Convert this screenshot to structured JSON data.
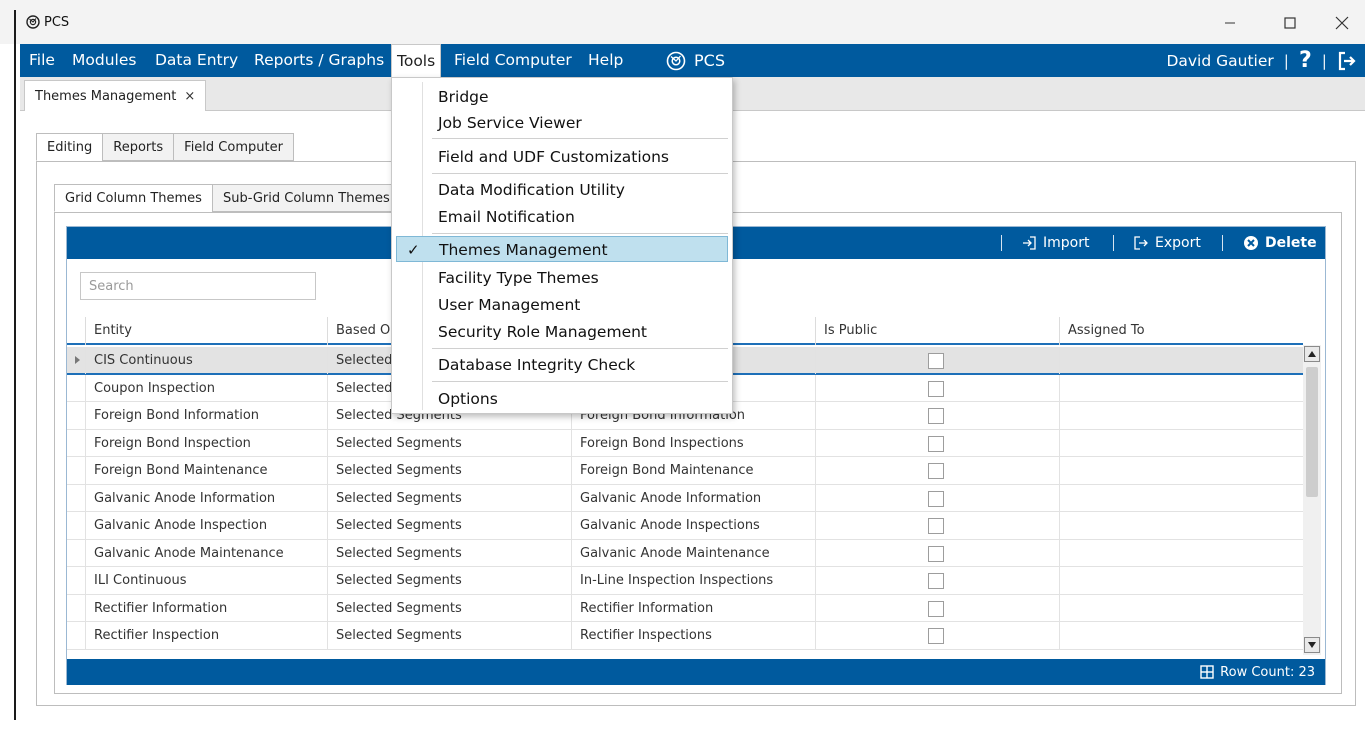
{
  "window": {
    "title": "PCS",
    "controls": [
      "—",
      "☐",
      "✕"
    ]
  },
  "menubar": {
    "items": [
      {
        "label": "File"
      },
      {
        "label": "Modules"
      },
      {
        "label": "Data Entry"
      },
      {
        "label": "Reports / Graphs"
      },
      {
        "label": "Tools"
      },
      {
        "label": "Field Computer"
      },
      {
        "label": "Help"
      }
    ],
    "brand": "PCS",
    "user": "David Gautier",
    "separator": "|",
    "help_glyph": "?"
  },
  "doc_tab": {
    "label": "Themes Management",
    "close": "×"
  },
  "editing_tabs": [
    "Editing",
    "Reports",
    "Field Computer"
  ],
  "theme_tabs": [
    "Grid Column Themes",
    "Sub-Grid Column Themes"
  ],
  "toolbar": {
    "import_label": "Import",
    "export_label": "Export",
    "delete_label": "Delete"
  },
  "search": {
    "placeholder": "Search"
  },
  "columns": [
    "Entity",
    "Based On",
    "",
    "Is Public",
    "Assigned To"
  ],
  "rows": [
    {
      "entity": "CIS Continuous",
      "based_on": "Selected",
      "source": "",
      "is_public": false
    },
    {
      "entity": "Coupon Inspection",
      "based_on": "Selected",
      "source": "",
      "is_public": false
    },
    {
      "entity": "Foreign Bond Information",
      "based_on": "Selected Segments",
      "source": "Foreign Bond Information",
      "is_public": false
    },
    {
      "entity": "Foreign Bond Inspection",
      "based_on": "Selected Segments",
      "source": "Foreign Bond Inspections",
      "is_public": false
    },
    {
      "entity": "Foreign Bond Maintenance",
      "based_on": "Selected Segments",
      "source": "Foreign Bond Maintenance",
      "is_public": false
    },
    {
      "entity": "Galvanic Anode Information",
      "based_on": "Selected Segments",
      "source": "Galvanic Anode Information",
      "is_public": false
    },
    {
      "entity": "Galvanic Anode Inspection",
      "based_on": "Selected Segments",
      "source": "Galvanic Anode Inspections",
      "is_public": false
    },
    {
      "entity": "Galvanic Anode Maintenance",
      "based_on": "Selected Segments",
      "source": "Galvanic Anode Maintenance",
      "is_public": false
    },
    {
      "entity": "ILI Continuous",
      "based_on": "Selected Segments",
      "source": "In-Line Inspection Inspections",
      "is_public": false
    },
    {
      "entity": "Rectifier Information",
      "based_on": "Selected Segments",
      "source": "Rectifier Information",
      "is_public": false
    },
    {
      "entity": "Rectifier Inspection",
      "based_on": "Selected Segments",
      "source": "Rectifier Inspections",
      "is_public": false
    }
  ],
  "footer": {
    "row_count": "Row Count: 23"
  },
  "tools_menu": {
    "groups": [
      [
        "Bridge",
        "Job Service Viewer"
      ],
      [
        "Field and UDF Customizations"
      ],
      [
        "Data Modification Utility",
        "Email Notification"
      ],
      [
        "Themes Management",
        "Facility Type Themes",
        "User Management",
        "Security Role Management"
      ],
      [
        "Database Integrity Check"
      ],
      [
        "Options"
      ]
    ],
    "checked_item": "Themes Management",
    "check_glyph": "✓"
  },
  "colors": {
    "brand_blue": "#005a9e",
    "selection_blue": "#bfe0ee",
    "accent_line": "#1d6fb8"
  }
}
